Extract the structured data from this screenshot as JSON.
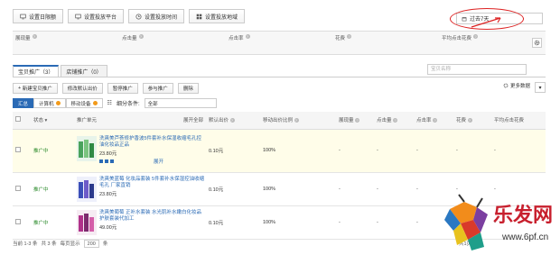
{
  "toolbar": {
    "daily_limit": "设置日限额",
    "platform": "设置投放平台",
    "time": "设置投放时间",
    "region": "设置投放地域"
  },
  "period": {
    "label": "过去7天"
  },
  "stats": [
    "展现量",
    "点击量",
    "点击率",
    "花费",
    "平均点击花费"
  ],
  "tabs": [
    {
      "label": "宝贝推广（3）"
    },
    {
      "label": "店铺推广（0）"
    }
  ],
  "search": {
    "placeholder": "宝贝名称"
  },
  "actions": {
    "new": "新建宝贝推广",
    "modify_bid": "修改默认出价",
    "pause": "暂停推广",
    "join": "参与推广",
    "delete": "删除",
    "more": "更多数据"
  },
  "filters": {
    "summary": "汇总",
    "computer": "计算机",
    "mobile": "移动设备",
    "filter_label": "细分条件:",
    "filter_value": "全部"
  },
  "columns": {
    "status": "状态",
    "unit": "推广单元",
    "expand_all": "展开全部",
    "default_bid": "默认出价",
    "mobile_ratio": "移动出价比例",
    "impressions": "展现量",
    "clicks": "点击量",
    "ctr": "点击率",
    "cost": "花费",
    "avg_cpc": "平均点击花费"
  },
  "rows": [
    {
      "status": "推广中",
      "name": "洗爽美芦荟修护香波5件套补水保湿收缩毛孔控油化妆品正品",
      "price": "23.80元",
      "expand": "展开",
      "bid": "0.10元",
      "ratio": "100%",
      "impressions": "-",
      "clicks": "-",
      "ctr": "-",
      "cost": "-",
      "avg": "-"
    },
    {
      "status": "推广中",
      "name": "洗爽美蓝莓 化妆品套装 5件套补水保湿控油收缩毛孔 厂家直销",
      "price": "23.80元",
      "bid": "0.10元",
      "ratio": "100%",
      "impressions": "-",
      "clicks": "-",
      "ctr": "-",
      "cost": "-",
      "avg": "-"
    },
    {
      "status": "推广中",
      "name": "洗爽美葡萄 正补水套装 水光肌补水嫩白化妆品护肤套装代加工",
      "price": "49.00元",
      "bid": "0.10元",
      "ratio": "100%",
      "impressions": "-",
      "clicks": "-",
      "ctr": "-",
      "cost": "-",
      "avg": "-"
    }
  ],
  "pager": {
    "range": "当前 1-3 条",
    "total": "共 3 条",
    "per_page_label": "每页显示",
    "per_page": "200",
    "unit": "条",
    "page_info": "共1页"
  },
  "watermark": {
    "brand": "乐发网",
    "url": "www.6pf.cn"
  },
  "colors": {
    "accent": "#2a6ab5",
    "status_green": "#2a8a2a",
    "highlight_row": "#fffde9",
    "annotation_red": "#d22222"
  }
}
